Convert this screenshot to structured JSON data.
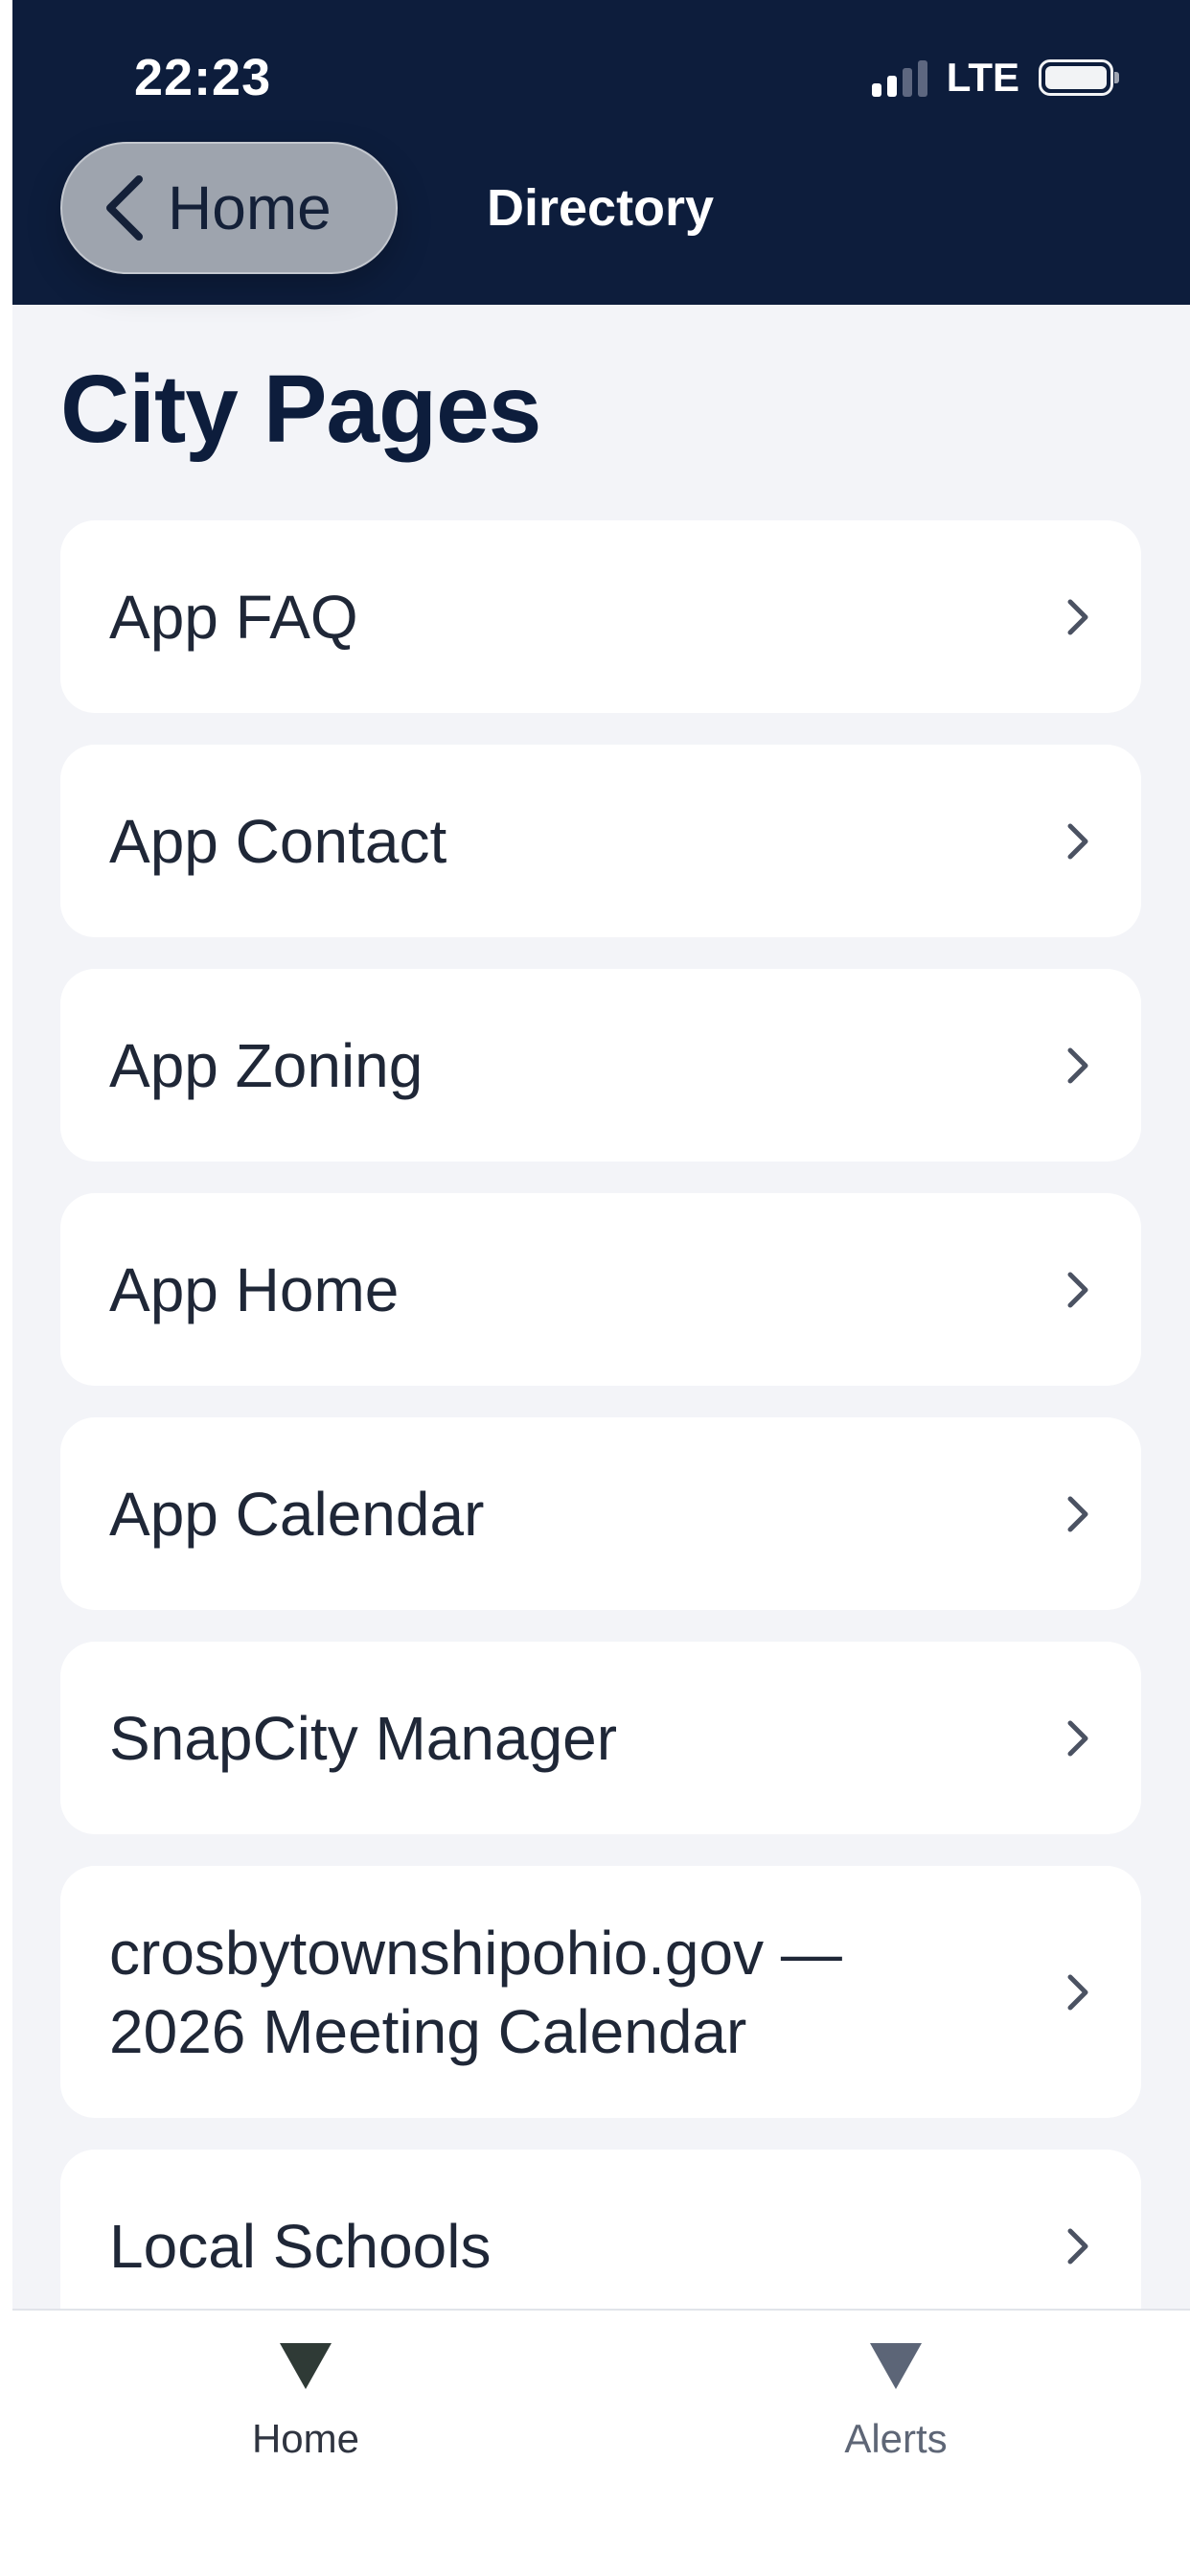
{
  "status_bar": {
    "time": "22:23",
    "network": "LTE"
  },
  "header": {
    "back_label": "Home",
    "title": "Directory",
    "background": "#0d1d3c"
  },
  "page": {
    "title": "City Pages"
  },
  "items": [
    {
      "label": "App FAQ"
    },
    {
      "label": "App Contact"
    },
    {
      "label": "App Zoning"
    },
    {
      "label": "App Home"
    },
    {
      "label": "App Calendar"
    },
    {
      "label": "SnapCity Manager"
    },
    {
      "label": "crosbytownshipohio.gov —\n2026 Meeting Calendar"
    },
    {
      "label": "Local Schools"
    }
  ],
  "tab_bar": {
    "tabs": [
      {
        "label": "Home",
        "icon": "triangle-down-icon",
        "active": true
      },
      {
        "label": "Alerts",
        "icon": "triangle-down-icon",
        "active": false
      }
    ]
  },
  "colors": {
    "page_background": "#f3f4f8",
    "card_background": "#ffffff",
    "title_text": "#0d1d3c",
    "chevron": "#4b5262"
  }
}
